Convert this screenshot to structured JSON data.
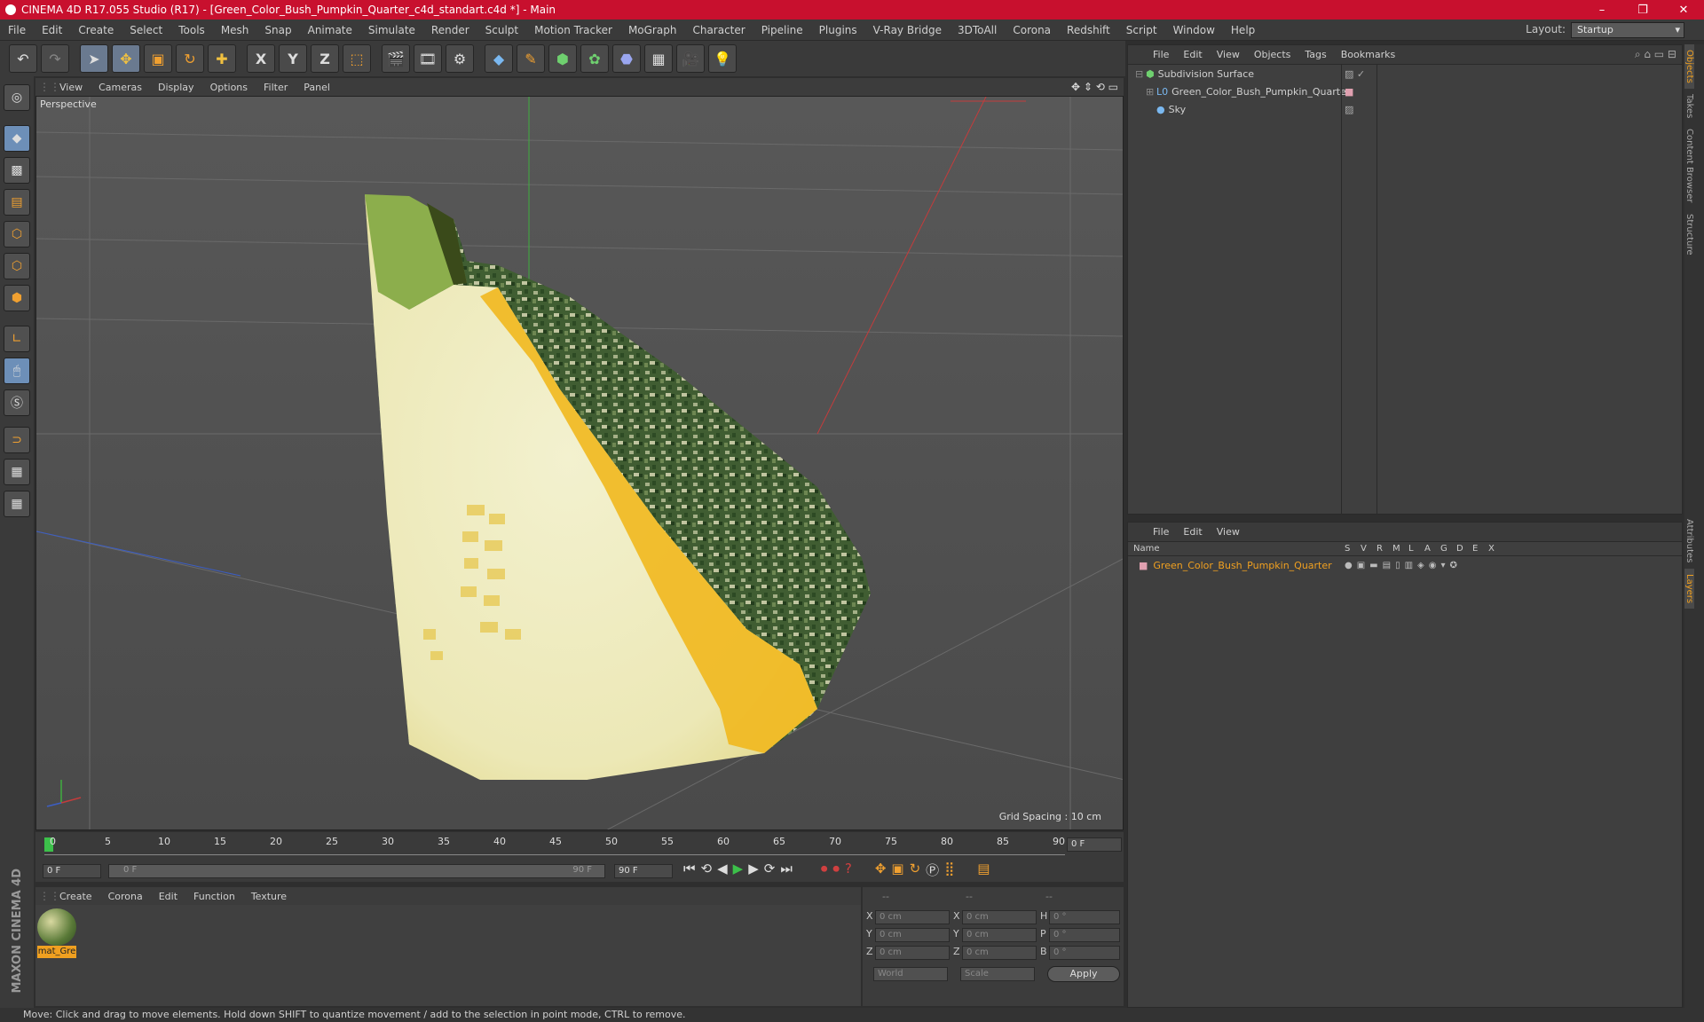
{
  "window": {
    "title": "CINEMA 4D R17.055 Studio (R17) - [Green_Color_Bush_Pumpkin_Quarter_c4d_standart.c4d *] - Main",
    "minimize": "–",
    "restore": "❐",
    "close": "✕"
  },
  "menubar": {
    "items": [
      "File",
      "Edit",
      "Create",
      "Select",
      "Tools",
      "Mesh",
      "Snap",
      "Animate",
      "Simulate",
      "Render",
      "Sculpt",
      "Motion Tracker",
      "MoGraph",
      "Character",
      "Pipeline",
      "Plugins",
      "V-Ray Bridge",
      "3DToAll",
      "Corona",
      "Redshift",
      "Script",
      "Window",
      "Help"
    ],
    "layout_label": "Layout:",
    "layout_value": "Startup"
  },
  "toolbar": {
    "axis_x": "X",
    "axis_y": "Y",
    "axis_z": "Z"
  },
  "viewport": {
    "menu": [
      "View",
      "Cameras",
      "Display",
      "Options",
      "Filter",
      "Panel"
    ],
    "label": "Perspective",
    "grid_spacing": "Grid Spacing : 10 cm"
  },
  "timeline": {
    "ticks": [
      "0",
      "5",
      "10",
      "15",
      "20",
      "25",
      "30",
      "35",
      "40",
      "45",
      "50",
      "55",
      "60",
      "65",
      "70",
      "75",
      "80",
      "85",
      "90"
    ],
    "current_frame": "0 F",
    "start": "0 F",
    "range_start": "0 F",
    "range_end": "90 F",
    "end": "90 F"
  },
  "material_manager": {
    "menu": [
      "Create",
      "Corona",
      "Edit",
      "Function",
      "Texture"
    ],
    "material_name": "mat_Gre"
  },
  "coordinates": {
    "header_left": "--",
    "header_mid": "--",
    "header_right": "--",
    "rows": [
      {
        "l1": "X",
        "v1": "0 cm",
        "l2": "X",
        "v2": "0 cm",
        "l3": "H",
        "v3": "0 °"
      },
      {
        "l1": "Y",
        "v1": "0 cm",
        "l2": "Y",
        "v2": "0 cm",
        "l3": "P",
        "v3": "0 °"
      },
      {
        "l1": "Z",
        "v1": "0 cm",
        "l2": "Z",
        "v2": "0 cm",
        "l3": "B",
        "v3": "0 °"
      }
    ],
    "mode": "World",
    "scale": "Scale",
    "apply": "Apply"
  },
  "object_manager": {
    "menu": [
      "File",
      "Edit",
      "View",
      "Objects",
      "Tags",
      "Bookmarks"
    ],
    "objects": [
      "Subdivision Surface",
      "Green_Color_Bush_Pumpkin_Quarter",
      "Sky"
    ]
  },
  "layer_manager": {
    "menu": [
      "File",
      "Edit",
      "View"
    ],
    "columns": [
      "Name",
      "S",
      "V",
      "R",
      "M",
      "L",
      "A",
      "G",
      "D",
      "E",
      "X"
    ],
    "layer_name": "Green_Color_Bush_Pumpkin_Quarter"
  },
  "right_dock": {
    "tabs": [
      "Objects",
      "Takes",
      "Content Browser",
      "Structure",
      "Attributes",
      "Layers"
    ]
  },
  "brand": "MAXON CINEMA 4D",
  "status": "Move: Click and drag to move elements. Hold down SHIFT to quantize movement / add to the selection in point mode, CTRL to remove."
}
